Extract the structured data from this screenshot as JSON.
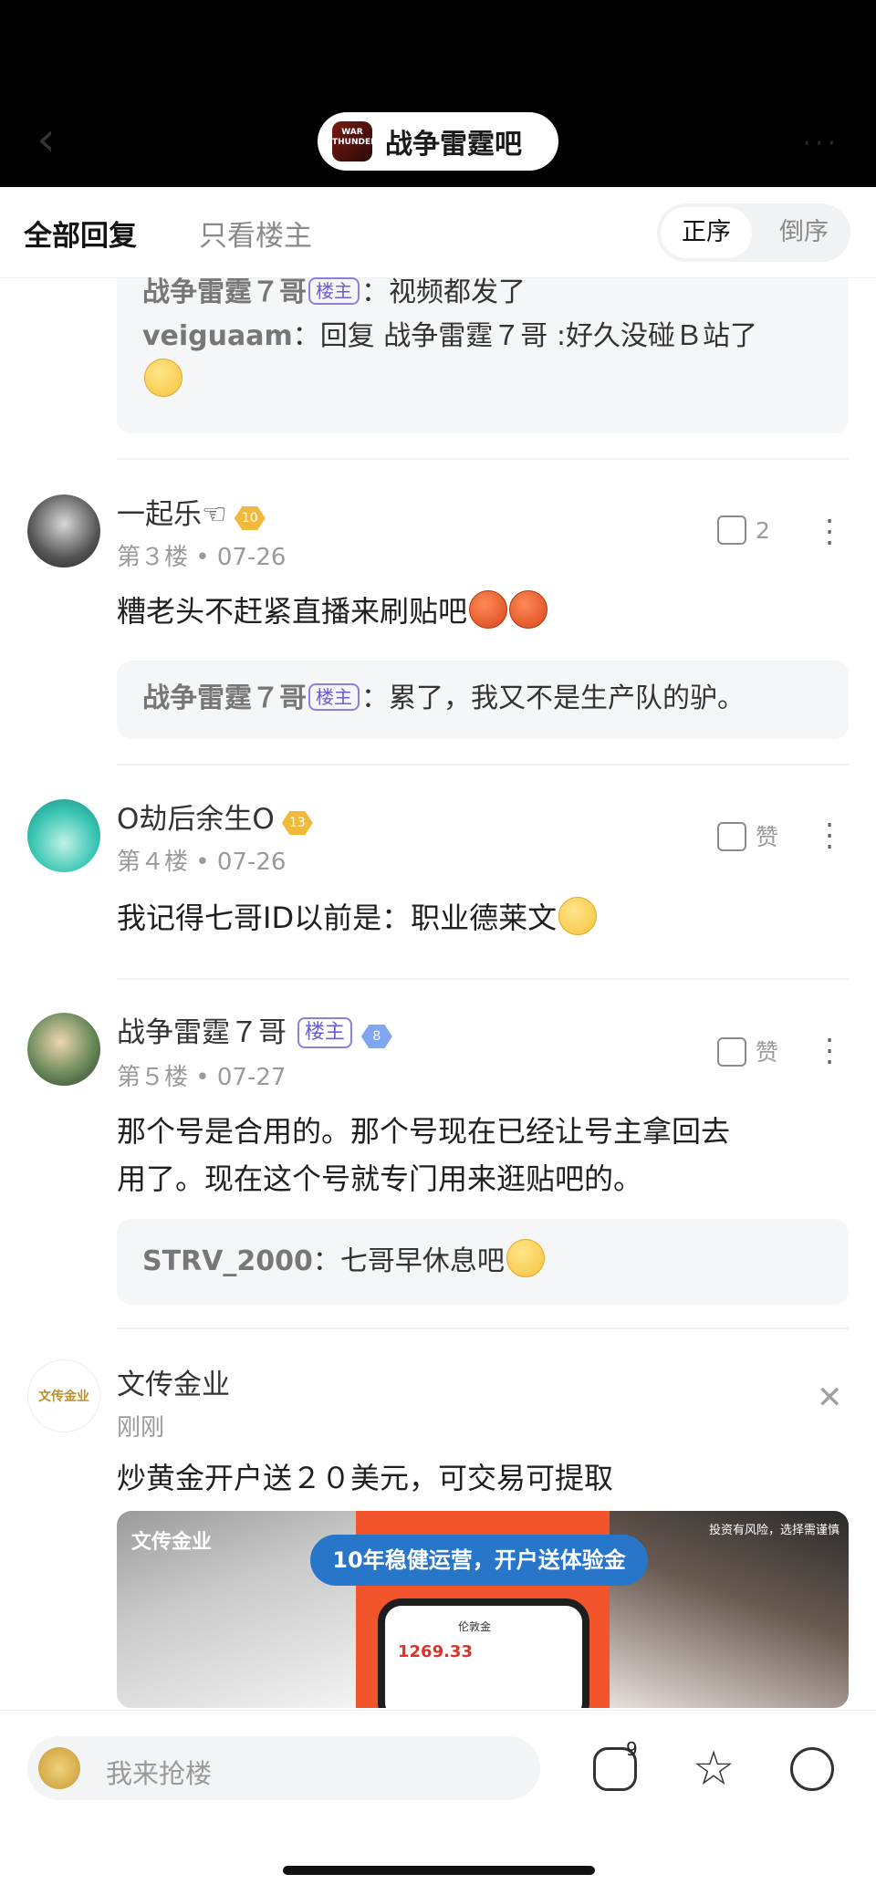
{
  "header": {
    "forum_name": "战争雷霆吧",
    "forum_logo_text": "WAR THUNDER"
  },
  "tabs": {
    "all": "全部回复",
    "op_only": "只看楼主",
    "order_asc": "正序",
    "order_desc": "倒序"
  },
  "top_replies": {
    "r1_user": "战争雷霆７哥",
    "r1_badge": "楼主",
    "r1_text": "：视频都发了",
    "r2_user": "veiguaam",
    "r2_text": "：回复 战争雷霆７哥 :好久没碰Ｂ站了"
  },
  "posts": [
    {
      "name": "一起乐☜",
      "level": "10",
      "meta": "第３楼 • 07-26",
      "like": "2",
      "text": "糟老头不赶紧直播来刷贴吧",
      "reply_user": "战争雷霆７哥",
      "reply_badge": "楼主",
      "reply_text": "：累了，我又不是生产队的驴。"
    },
    {
      "name": "O劫后余生O",
      "level": "13",
      "meta": "第４楼 • 07-26",
      "like": "赞",
      "text": "我记得七哥ID以前是：职业德莱文"
    },
    {
      "name": "战争雷霆７哥",
      "badge": "楼主",
      "level": "8",
      "meta": "第５楼 • 07-27",
      "like": "赞",
      "text_line1": "那个号是合用的。那个号现在已经让号主拿回去",
      "text_line2": "用了。现在这个号就专门用来逛贴吧的。",
      "reply_user": "STRV_2000",
      "reply_text": "：七哥早休息吧"
    }
  ],
  "ad": {
    "name": "文传金业",
    "time": "刚刚",
    "text": "炒黄金开户送２０美元，可交易可提取",
    "logo_text": "文传金业",
    "brand": "文传金业",
    "banner": "10年稳健运营，开户送体验金",
    "risk": "投资有风险，选择需谨慎",
    "phone_title": "伦敦金",
    "phone_price": "1269.33"
  },
  "bottom": {
    "input_placeholder": "我来抢楼",
    "comment_count": "9"
  }
}
